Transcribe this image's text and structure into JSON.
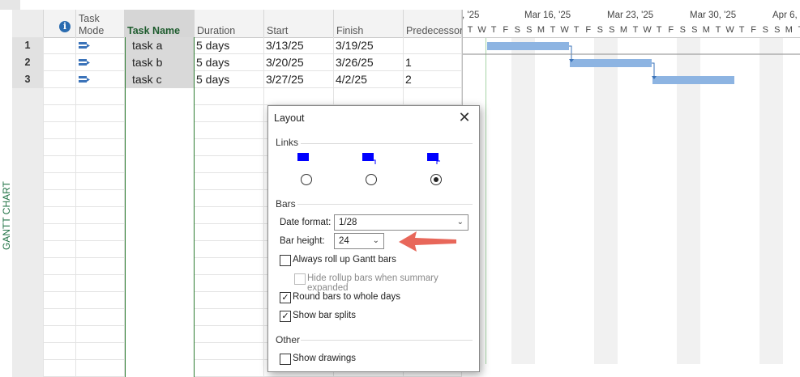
{
  "view_bar": {
    "label": "GANTT CHART"
  },
  "grid": {
    "headers": {
      "task_mode": [
        "Task",
        "Mode"
      ],
      "task_name": "Task Name",
      "duration": "Duration",
      "start": "Start",
      "finish": "Finish",
      "predecessors": "Predecessors",
      "info_icon": "i"
    },
    "rows": [
      {
        "id": "1",
        "name": "task a",
        "duration": "5 days",
        "start": "3/13/25",
        "finish": "3/19/25",
        "predecessors": ""
      },
      {
        "id": "2",
        "name": "task b",
        "duration": "5 days",
        "start": "3/20/25",
        "finish": "3/26/25",
        "predecessors": "1"
      },
      {
        "id": "3",
        "name": "task c",
        "duration": "5 days",
        "start": "3/27/25",
        "finish": "4/2/25",
        "predecessors": "2"
      }
    ]
  },
  "gantt": {
    "weeks": [
      ", '25",
      "Mar 16, '25",
      "Mar 23, '25",
      "Mar 30, '25",
      "Apr 6, '25"
    ],
    "days": [
      "T",
      "W",
      "T",
      "F",
      "S",
      "S",
      "M",
      "T",
      "W",
      "T",
      "F",
      "S",
      "S",
      "M",
      "T",
      "W",
      "T",
      "F",
      "S",
      "S",
      "M",
      "T",
      "W",
      "T",
      "F",
      "S",
      "S",
      "M",
      "T",
      "W"
    ],
    "bar_color": "#8db4e2"
  },
  "dialog": {
    "title": "Layout",
    "close": "✕",
    "links_label": "Links",
    "link_selected_index": 2,
    "bars_label": "Bars",
    "date_format_label": "Date format:",
    "date_format_value": "1/28",
    "bar_height_label": "Bar height:",
    "bar_height_value": "24",
    "always_roll_up": "Always roll up Gantt bars",
    "hide_rollup": "Hide rollup bars when summary expanded",
    "round_bars": "Round bars to whole days",
    "show_splits": "Show bar splits",
    "other_label": "Other",
    "show_drawings": "Show drawings",
    "checks": {
      "always_roll_up": false,
      "hide_rollup": false,
      "round_bars": true,
      "show_splits": true,
      "show_drawings": false
    },
    "accent": "#0000ff"
  },
  "annotation": {
    "arrow_color": "#e8675a"
  }
}
